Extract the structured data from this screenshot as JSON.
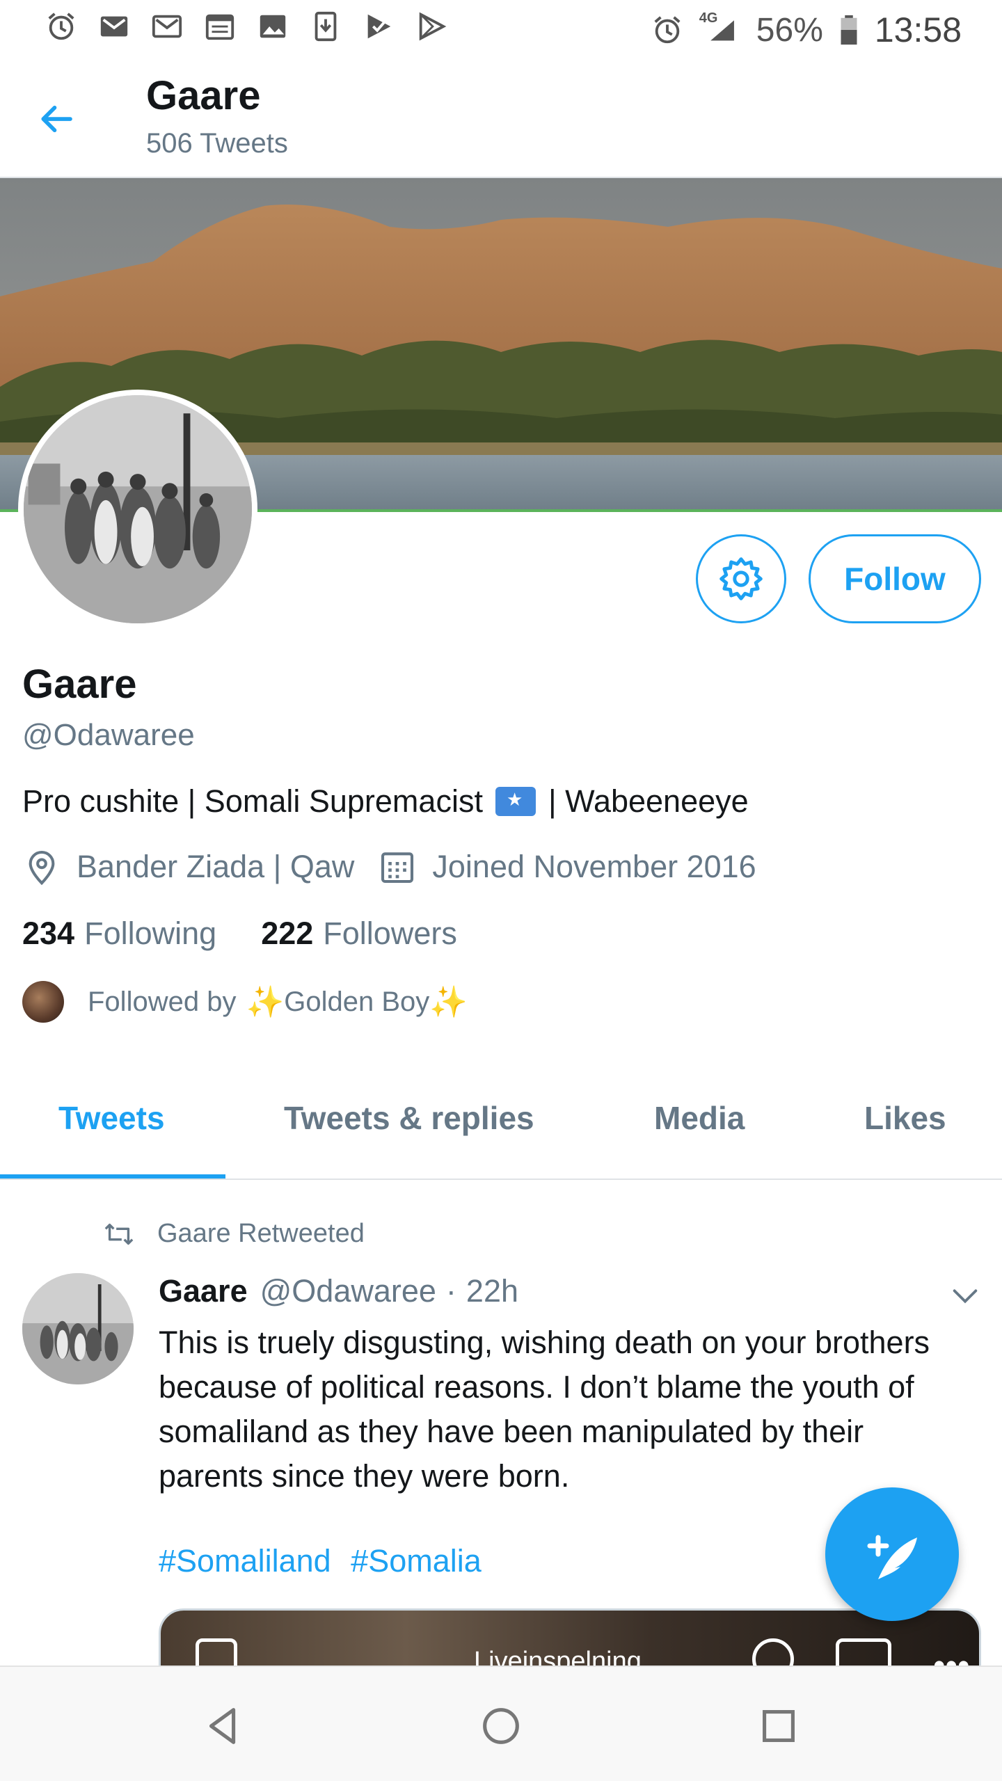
{
  "status_bar": {
    "battery": "56%",
    "network": "4G",
    "time": "13:58",
    "left_icons": [
      "alarm-icon",
      "gmail-icon",
      "gmail-icon",
      "calendar-icon",
      "gallery-icon",
      "download-icon",
      "play-store-icon",
      "play-icon"
    ]
  },
  "header": {
    "title": "Gaare",
    "subtitle": "506 Tweets"
  },
  "profile": {
    "follow_label": "Follow",
    "name": "Gaare",
    "handle": "@Odawaree",
    "bio_part1": "Pro cushite | Somali Supremacist",
    "bio_part2": "| Wabeeneeye",
    "location": "Bander Ziada | Qaw",
    "joined": "Joined November 2016",
    "following_count": "234",
    "following_label": "Following",
    "followers_count": "222",
    "followers_label": "Followers",
    "followed_by_prefix": "Followed by",
    "followed_by_name": "Golden Boy",
    "sparkle": "✨"
  },
  "tabs": [
    {
      "label": "Tweets",
      "active": true
    },
    {
      "label": "Tweets & replies",
      "active": false
    },
    {
      "label": "Media",
      "active": false
    },
    {
      "label": "Likes",
      "active": false
    }
  ],
  "tweet": {
    "retweet_label": "Gaare Retweeted",
    "author_name": "Gaare",
    "author_handle": "@Odawaree",
    "separator": "·",
    "time": "22h",
    "text": "This is truely disgusting, wishing death on your brothers because of political reasons. I don’t blame the youth of somaliland as they have been manipulated by their parents since they were born.",
    "hashtags": [
      "#Somaliland",
      "#Somalia"
    ],
    "media_label": "Liveinspelning"
  },
  "colors": {
    "accent": "#1da1f2",
    "secondary_text": "#657786",
    "primary_text": "#14171a"
  }
}
